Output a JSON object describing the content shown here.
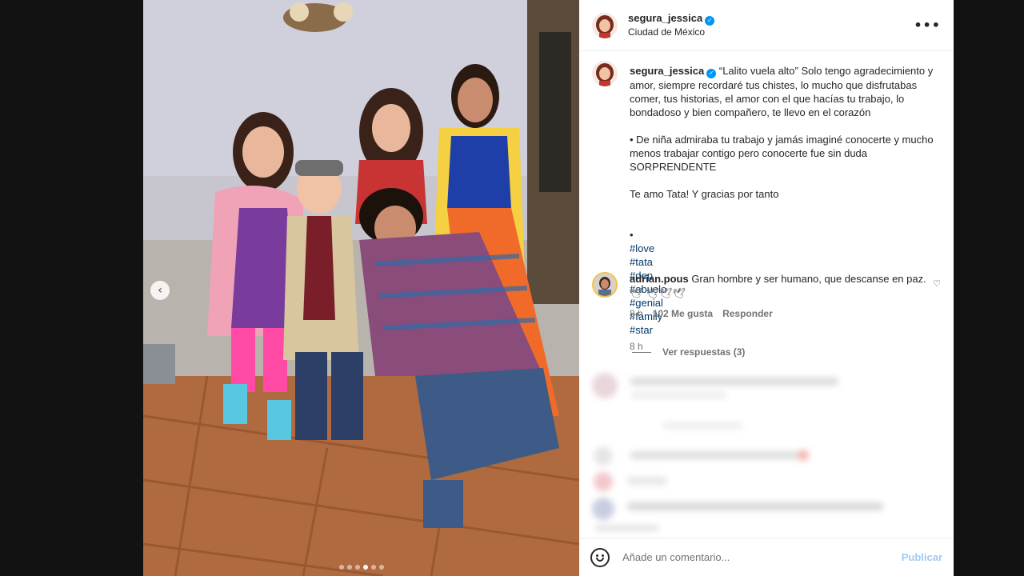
{
  "post": {
    "username": "segura_jessica",
    "location": "Ciudad de México",
    "verified_icon": "verified-badge-icon",
    "more_icon": "more-options-icon"
  },
  "caption": {
    "username": "segura_jessica",
    "line1": "“Lalito vuela alto” Solo tengo agradecimiento y amor, siempre recordaré tus chistes, lo mucho que disfrutabas comer, tus historias, el amor con el que hacías tu trabajo, lo bondadoso y bien compañero, te llevo en el corazón",
    "line2": "• De niña admiraba tu trabajo y jamás imaginé conocerte y mucho menos trabajar contigo pero conocerte fue sin duda SORPRENDENTE",
    "line3": "Te amo Tata! Y gracias por tanto",
    "hashtag_prefix": "•",
    "hashtags": [
      "#love",
      "#tata",
      "#dep",
      "#abuelo",
      "#genial",
      "#family",
      "#star"
    ],
    "time": "8 h"
  },
  "comment": {
    "username": "adrian.pous",
    "text": "Gran hombre y ser humano, que descanse en paz.",
    "emojis": "🕊 🕊🕊🕊",
    "time": "8 h",
    "likes": "102 Me gusta",
    "reply": "Responder",
    "view_replies": "Ver respuestas (3)"
  },
  "footer": {
    "placeholder": "Añade un comentario...",
    "publish": "Publicar"
  },
  "carousel": {
    "prev_icon": "chevron-left-icon",
    "dot_count": 6,
    "active_index": 3
  }
}
